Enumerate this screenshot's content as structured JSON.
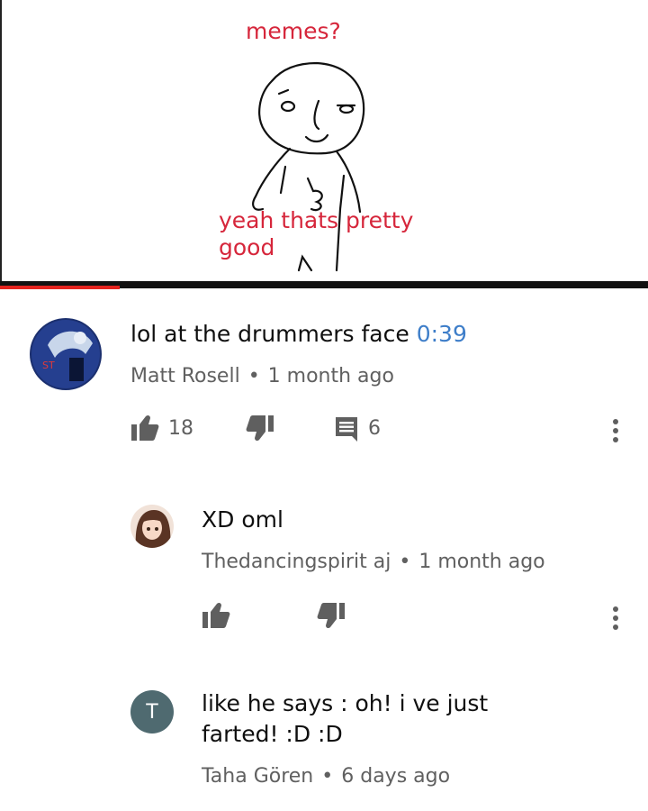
{
  "video": {
    "meme_top_text": "memes?",
    "meme_bottom_text_line1": "yeah thats pretty",
    "meme_bottom_text_line2": "good",
    "progress_fraction": 0.185
  },
  "comments": [
    {
      "text_before": "lol at the drummers face ",
      "timestamp": "0:39",
      "author": "Matt Rosell",
      "separator": "•",
      "age": "1 month ago",
      "likes": "18",
      "replies": "6"
    },
    {
      "text": "XD oml",
      "author": "Thedancingspirit aj",
      "separator": "•",
      "age": "1 month ago"
    },
    {
      "text_line1": "like he says : oh! i ve just",
      "text_line2": "farted! :D :D",
      "author": "Taha Gören",
      "separator": "•",
      "age": "6 days ago",
      "avatar_letter": "T"
    }
  ],
  "colors": {
    "progress": "#e4231e",
    "timestamp_link": "#3e7ec9",
    "meme_text": "#d6263b",
    "avatar_letter_bg": "#4f6a70"
  },
  "icons": [
    "thumb-up-icon",
    "thumb-down-icon",
    "comment-icon",
    "more-vert-icon"
  ]
}
